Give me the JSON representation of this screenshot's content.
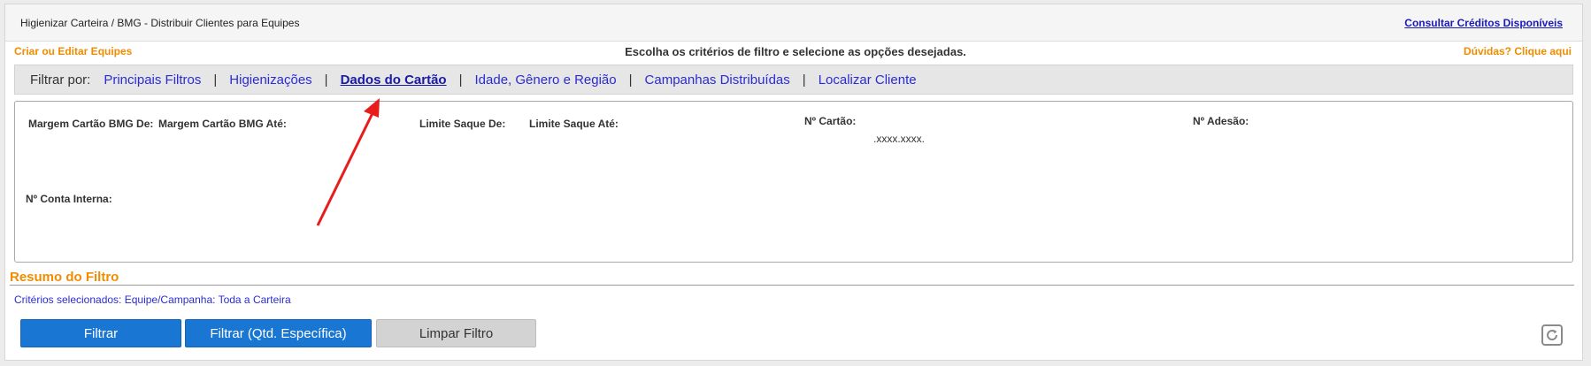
{
  "header": {
    "breadcrumb": "Higienizar Carteira / BMG - Distribuir Clientes para Equipes",
    "credits_link": "Consultar Créditos Disponíveis"
  },
  "subheader": {
    "teams_link": "Criar ou Editar Equipes",
    "instructions": "Escolha os critérios de filtro e selecione as opções desejadas.",
    "help_link": "Dúvidas? Clique aqui"
  },
  "filterbar": {
    "label": "Filtrar por:",
    "separator": "|",
    "tabs": [
      {
        "label": "Principais Filtros"
      },
      {
        "label": "Higienizações"
      },
      {
        "label": "Dados do Cartão"
      },
      {
        "label": "Idade, Gênero e Região"
      },
      {
        "label": "Campanhas Distribuídas"
      },
      {
        "label": "Localizar Cliente"
      }
    ],
    "active_tab": "Dados do Cartão"
  },
  "fields": {
    "margem_de": {
      "label": "Margem Cartão BMG De:",
      "value": ""
    },
    "margem_ate": {
      "label": "Margem Cartão BMG Até:",
      "value": ""
    },
    "limite_de": {
      "label": "Limite Saque De:",
      "value": ""
    },
    "limite_ate": {
      "label": "Limite Saque Até:",
      "value": ""
    },
    "cartao": {
      "label": "Nº Cartão:",
      "mask": ".xxxx.xxxx.",
      "value_prefix": "",
      "value_suffix": ""
    },
    "adesao": {
      "label": "Nº Adesão:",
      "value": ""
    },
    "conta_interna": {
      "label": "Nº Conta Interna:",
      "value": ""
    }
  },
  "summary": {
    "title": "Resumo do Filtro",
    "criteria": "Critérios selecionados: Equipe/Campanha: Toda a Carteira"
  },
  "buttons": {
    "filter": "Filtrar",
    "filter_qty": "Filtrar (Qtd. Específica)",
    "clear": "Limpar Filtro"
  },
  "icons": {
    "refresh": "refresh-icon",
    "annotation": "red-arrow-annotation"
  },
  "colors": {
    "accent_orange": "#f08c00",
    "link_blue": "#2b2bd6",
    "button_blue": "#1976d2",
    "annotation_red": "#e81c1c"
  }
}
